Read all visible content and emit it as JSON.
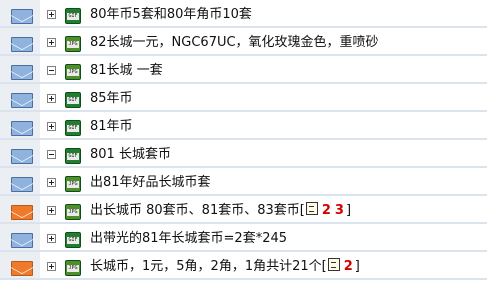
{
  "threads": [
    {
      "title": "80年币5套和80年角币10套",
      "expander": "plus",
      "icon": "gif",
      "mail": "blue"
    },
    {
      "title": "82长城一元，NGC67UC，氧化玫瑰金色，重喷砂",
      "expander": "plus",
      "icon": "jpg",
      "mail": "blue"
    },
    {
      "title": "81长城 一套",
      "expander": "minus",
      "icon": "jpg",
      "mail": "blue"
    },
    {
      "title": "85年币",
      "expander": "plus",
      "icon": "gif",
      "mail": "blue"
    },
    {
      "title": "81年币",
      "expander": "plus",
      "icon": "gif",
      "mail": "blue"
    },
    {
      "title": "801 长城套币",
      "expander": "minus",
      "icon": "gif",
      "mail": "blue"
    },
    {
      "title": "出81年好品长城币套",
      "expander": "plus",
      "icon": "jpg",
      "mail": "blue"
    },
    {
      "title": "出长城币 80套币、81套币、83套币",
      "expander": "plus",
      "icon": "jpg",
      "mail": "orange",
      "pages": {
        "open": "[",
        "links": [
          "2",
          "3"
        ],
        "close": "]"
      }
    },
    {
      "title": "出带光的81年长城套币=2套*245",
      "expander": "plus",
      "icon": "gif",
      "mail": "blue"
    },
    {
      "title": "长城币，1元，5角，2角，1角共计21个",
      "expander": "plus",
      "icon": "jpg",
      "mail": "orange",
      "pages": {
        "open": "[",
        "links": [
          "2"
        ],
        "close": "]"
      }
    }
  ],
  "icon_labels": {
    "gif": "GIF",
    "jpg": "JPG"
  },
  "colors": {
    "row_border": "#dbe3ee",
    "mail_column_bg": "#ebeff4",
    "envelope_blue": "#8fb3de",
    "envelope_orange": "#f07a2c",
    "page_link": "#d40000"
  }
}
